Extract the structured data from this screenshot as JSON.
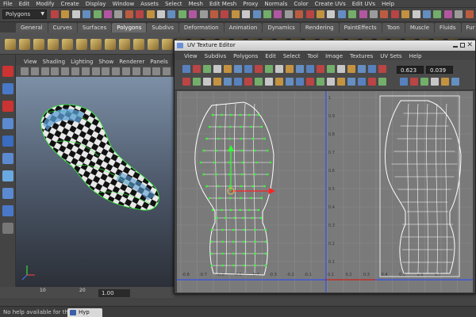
{
  "menubar": [
    "File",
    "Edit",
    "Modify",
    "Create",
    "Display",
    "Window",
    "Assets",
    "Select",
    "Mesh",
    "Edit Mesh",
    "Proxy",
    "Normals",
    "Color",
    "Create UVs",
    "Edit UVs",
    "Help"
  ],
  "mode_select": "Polygons",
  "shelf_tabs": [
    {
      "label": "General",
      "active": false
    },
    {
      "label": "Curves",
      "active": false
    },
    {
      "label": "Surfaces",
      "active": false
    },
    {
      "label": "Polygons",
      "active": true
    },
    {
      "label": "Subdivs",
      "active": false
    },
    {
      "label": "Deformation",
      "active": false
    },
    {
      "label": "Animation",
      "active": false
    },
    {
      "label": "Dynamics",
      "active": false
    },
    {
      "label": "Rendering",
      "active": false
    },
    {
      "label": "PaintEffects",
      "active": false
    },
    {
      "label": "Toon",
      "active": false
    },
    {
      "label": "Muscle",
      "active": false
    },
    {
      "label": "Fluids",
      "active": false
    },
    {
      "label": "Fur",
      "active": false
    }
  ],
  "panel_menu": [
    "View",
    "Shading",
    "Lighting",
    "Show",
    "Renderer",
    "Panels"
  ],
  "timeline": {
    "tick_10": "10",
    "tick_20": "20",
    "current": "1.00"
  },
  "uv_editor": {
    "title": "UV Texture Editor",
    "menu": [
      "View",
      "Subdivs",
      "Polygons",
      "Edit",
      "Select",
      "Tool",
      "Image",
      "Textures",
      "UV Sets",
      "Help"
    ],
    "u_value": "0.623",
    "v_value": "0.039",
    "grid_labels_v": [
      "1",
      "0.9",
      "0.8",
      "0.7",
      "0.6",
      "0.5",
      "0.4",
      "0.3",
      "0.2",
      "0.1"
    ],
    "grid_labels_u": [
      "-0.8",
      "-0.7",
      "-0.6",
      "-0.5",
      "-0.4",
      "-0.3",
      "-0.2",
      "-0.1",
      "0.1",
      "0.2",
      "0.3",
      "0.4",
      "0.5",
      "0.6",
      "0.7"
    ]
  },
  "helpline": "No help available for this tool",
  "bottom_tab": "Hyp",
  "colors": {
    "accent_green": "#33ff33",
    "uv_white": "#ffffff",
    "manip_red": "#ff2222",
    "axis_blue": "#2244ff"
  }
}
